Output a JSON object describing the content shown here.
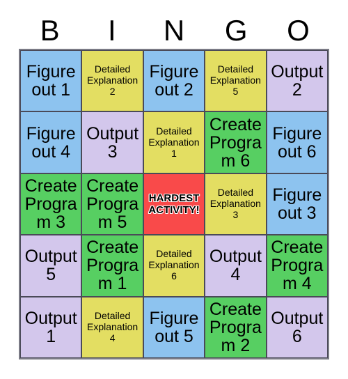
{
  "card": {
    "title": "BINGO",
    "headers": [
      "B",
      "I",
      "N",
      "G",
      "O"
    ],
    "colors": {
      "blue": "#8dc3ef",
      "yellow": "#e3de62",
      "purple": "#d3c7ec",
      "green": "#57cf62",
      "red": "#f94a4a",
      "border": "#5a5a66",
      "background": "#ffffff",
      "text": "#000000"
    },
    "rows": [
      [
        {
          "text": "Figure out 1",
          "color": "#8dc3ef",
          "size": "lg"
        },
        {
          "text": "Detailed Explanation 2",
          "color": "#e3de62",
          "size": "sm"
        },
        {
          "text": "Figure out 2",
          "color": "#8dc3ef",
          "size": "lg"
        },
        {
          "text": "Detailed Explanation 5",
          "color": "#e3de62",
          "size": "sm"
        },
        {
          "text": "Output 2",
          "color": "#d3c7ec",
          "size": "lg"
        }
      ],
      [
        {
          "text": "Figure out 4",
          "color": "#8dc3ef",
          "size": "lg"
        },
        {
          "text": "Output 3",
          "color": "#d3c7ec",
          "size": "lg"
        },
        {
          "text": "Detailed Explanation 1",
          "color": "#e3de62",
          "size": "sm"
        },
        {
          "text": "Create Program 6",
          "color": "#57cf62",
          "size": "lg"
        },
        {
          "text": "Figure out 6",
          "color": "#8dc3ef",
          "size": "lg"
        }
      ],
      [
        {
          "text": "Create Program 3",
          "color": "#57cf62",
          "size": "lg"
        },
        {
          "text": "Create Program 5",
          "color": "#57cf62",
          "size": "lg"
        },
        {
          "text": "HARDEST ACTIVITY!",
          "color": "#f94a4a",
          "size": "free"
        },
        {
          "text": "Detailed Explanation 3",
          "color": "#e3de62",
          "size": "sm"
        },
        {
          "text": "Figure out 3",
          "color": "#8dc3ef",
          "size": "lg"
        }
      ],
      [
        {
          "text": "Output 5",
          "color": "#d3c7ec",
          "size": "lg"
        },
        {
          "text": "Create Program 1",
          "color": "#57cf62",
          "size": "lg"
        },
        {
          "text": "Detailed Explanation 6",
          "color": "#e3de62",
          "size": "sm"
        },
        {
          "text": "Output 4",
          "color": "#d3c7ec",
          "size": "lg"
        },
        {
          "text": "Create Program 4",
          "color": "#57cf62",
          "size": "lg"
        }
      ],
      [
        {
          "text": "Output 1",
          "color": "#d3c7ec",
          "size": "lg"
        },
        {
          "text": "Detailed Explanation 4",
          "color": "#e3de62",
          "size": "sm"
        },
        {
          "text": "Figure out 5",
          "color": "#8dc3ef",
          "size": "lg"
        },
        {
          "text": "Create Program 2",
          "color": "#57cf62",
          "size": "lg"
        },
        {
          "text": "Output 6",
          "color": "#d3c7ec",
          "size": "lg"
        }
      ]
    ]
  }
}
